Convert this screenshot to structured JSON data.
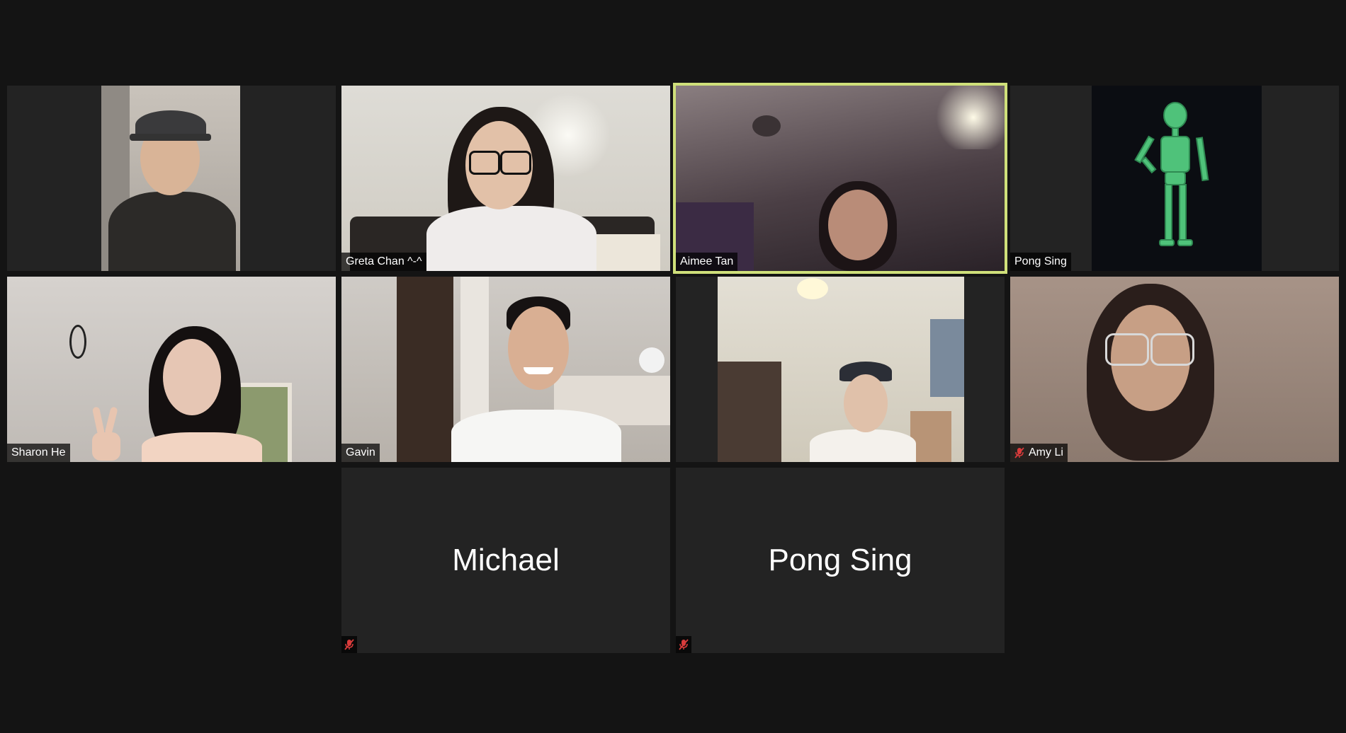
{
  "meeting": {
    "participants": [
      {
        "id": "p1",
        "name": ""
      },
      {
        "id": "p2",
        "name": "Greta Chan ^-^"
      },
      {
        "id": "p3",
        "name": "Aimee Tan"
      },
      {
        "id": "p4",
        "name": "Pong Sing"
      },
      {
        "id": "p5",
        "name": "Sharon He"
      },
      {
        "id": "p6",
        "name": "Gavin"
      },
      {
        "id": "p7",
        "name": ""
      },
      {
        "id": "p8",
        "name": "Amy Li"
      },
      {
        "id": "p9",
        "name": "Michael"
      },
      {
        "id": "p10",
        "name": "Pong Sing"
      }
    ],
    "active_speaker": "Aimee Tan",
    "muted_participants": [
      "Amy Li",
      "Michael",
      "Pong Sing"
    ]
  },
  "colors": {
    "background": "#141414",
    "tile": "#232323",
    "active_border": "#cfe07a",
    "mute_red": "#d93b3b",
    "label_text": "#ffffff"
  },
  "icons": {
    "mute": "muted-microphone-icon"
  }
}
